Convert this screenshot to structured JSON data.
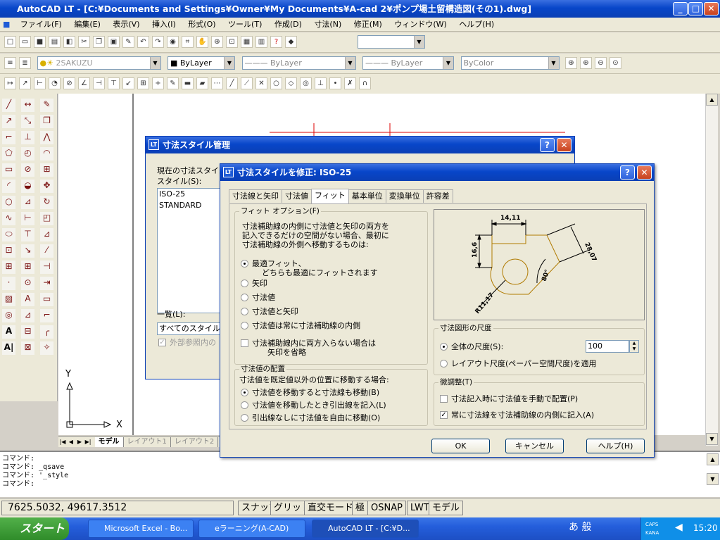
{
  "window": {
    "title": "AutoCAD LT - [C:¥Documents and Settings¥Owner¥My Documents¥A-cad 2¥ポンプ場土留構造図(その1).dwg]",
    "logo": "LT"
  },
  "menu": [
    "ファイル(F)",
    "編集(E)",
    "表示(V)",
    "挿入(I)",
    "形式(O)",
    "ツール(T)",
    "作成(D)",
    "寸法(N)",
    "修正(M)",
    "ウィンドウ(W)",
    "ヘルプ(H)"
  ],
  "layers": {
    "current": "2SAKUZU",
    "color": "ByLayer",
    "linetype": "ByLayer",
    "lineweight": "ByLayer",
    "plotstyle": "ByColor"
  },
  "ucs": {
    "x": "X",
    "y": "Y"
  },
  "layout_tabs": [
    "モデル",
    "レイアウト1",
    "レイアウト2"
  ],
  "command_lines": [
    "コマンド:",
    "コマンド: _qsave",
    "コマンド: '_style",
    "コマンド:"
  ],
  "status": {
    "coords": "7625.5032,  49617.3512",
    "buttons": [
      "スナップ",
      "グリッド",
      "直交モード",
      "極",
      "OSNAP",
      "LWT",
      "モデル"
    ]
  },
  "taskbar": {
    "start": "スタート",
    "tasks": [
      "Microsoft Excel - Bo...",
      "eラーニング(A-CAD)",
      "AutoCAD LT - [C:¥D..."
    ],
    "clock": "15:20",
    "caps": "CAPS",
    "kana": "KANA",
    "ime": "あ 般"
  },
  "dim_manager": {
    "title": "寸法スタイル管理",
    "current_label": "現在の寸法スタイル",
    "styles_label": "スタイル(S):",
    "styles": [
      "ISO-25",
      "STANDARD"
    ],
    "list_label": "一覧(L):",
    "list_value": "すべてのスタイル",
    "xref_label": "外部参照内の"
  },
  "modify": {
    "title": "寸法スタイルを修正: ISO-25",
    "tabs": [
      "寸法線と矢印",
      "寸法値",
      "フィット",
      "基本単位",
      "変換単位",
      "許容差"
    ],
    "fit_options": {
      "label": "フィット オプション(F)",
      "desc": [
        "寸法補助線の内側に寸法値と矢印の両方を",
        "記入できるだけの空間がない場合、最初に",
        "寸法補助線の外側へ移動するものは:"
      ],
      "opt1": "最適フィット、",
      "opt1b": "どちらも最適にフィットされます",
      "opt2": "矢印",
      "opt3": "寸法値",
      "opt4": "寸法値と矢印",
      "opt5": "寸法値は常に寸法補助線の内側",
      "suppress1": "寸法補助線内に両方入らない場合は",
      "suppress2": "矢印を省略"
    },
    "text_place": {
      "label": "寸法値の配置",
      "desc": "寸法値を既定値以外の位置に移動する場合:",
      "opt1": "寸法値を移動すると寸法線も移動(B)",
      "opt2": "寸法値を移動したとき引出線を記入(L)",
      "opt3": "引出線なしに寸法値を自由に移動(O)"
    },
    "scale": {
      "label": "寸法図形の尺度",
      "overall": "全体の尺度(S):",
      "value": "100",
      "layout": "レイアウト尺度(ペーパー空間尺度)を適用"
    },
    "fine": {
      "label": "微調整(T)",
      "manual": "寸法記入時に寸法値を手動で配置(P)",
      "always": "常に寸法線を寸法補助線の内側に記入(A)"
    },
    "preview": {
      "d1": "14,11",
      "d2": "16,6",
      "d3": "28,07",
      "d4": "80°",
      "d5": "R11,17"
    },
    "buttons": {
      "ok": "OK",
      "cancel": "キャンセル",
      "help": "ヘルプ(H)"
    }
  },
  "colors": {
    "accent": "#0846c9",
    "canvas": "#ffffff",
    "dim_line": "#b07a00"
  }
}
